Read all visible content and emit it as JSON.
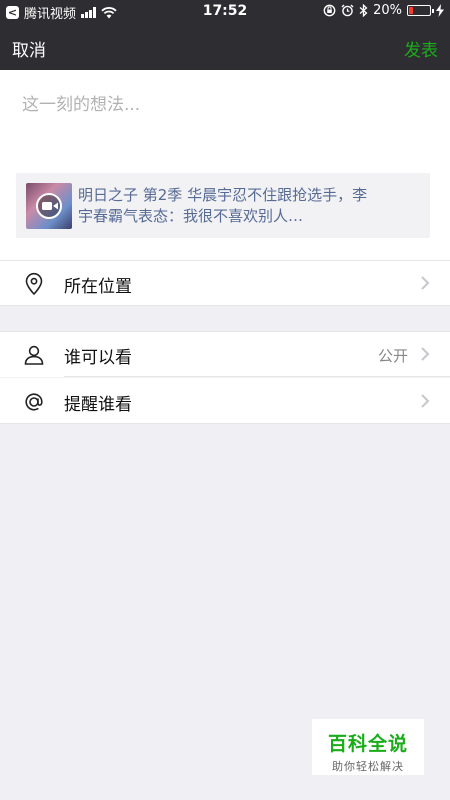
{
  "status_bar": {
    "back_app_label": "腾讯视频",
    "time": "17:52",
    "battery_percent_text": "20%",
    "battery_level": 0.2,
    "back_app_glyph": "<"
  },
  "nav": {
    "cancel_label": "取消",
    "post_label": "发表",
    "post_color": "#1aad19"
  },
  "compose": {
    "placeholder": "这一刻的想法...",
    "share_card": {
      "title": "明日之子 第2季 华晨宇忍不住跟抢选手，李宇春霸气表态：我很不喜欢别人…",
      "icon": "video-play-icon"
    }
  },
  "location_row": {
    "label": "所在位置",
    "icon": "location-pin-icon"
  },
  "visibility_row": {
    "label": "谁可以看",
    "value": "公开",
    "icon": "person-icon"
  },
  "mention_row": {
    "label": "提醒谁看",
    "icon": "at-icon"
  },
  "watermark": {
    "title": "百科全说",
    "subtitle": "助你轻松解决"
  }
}
